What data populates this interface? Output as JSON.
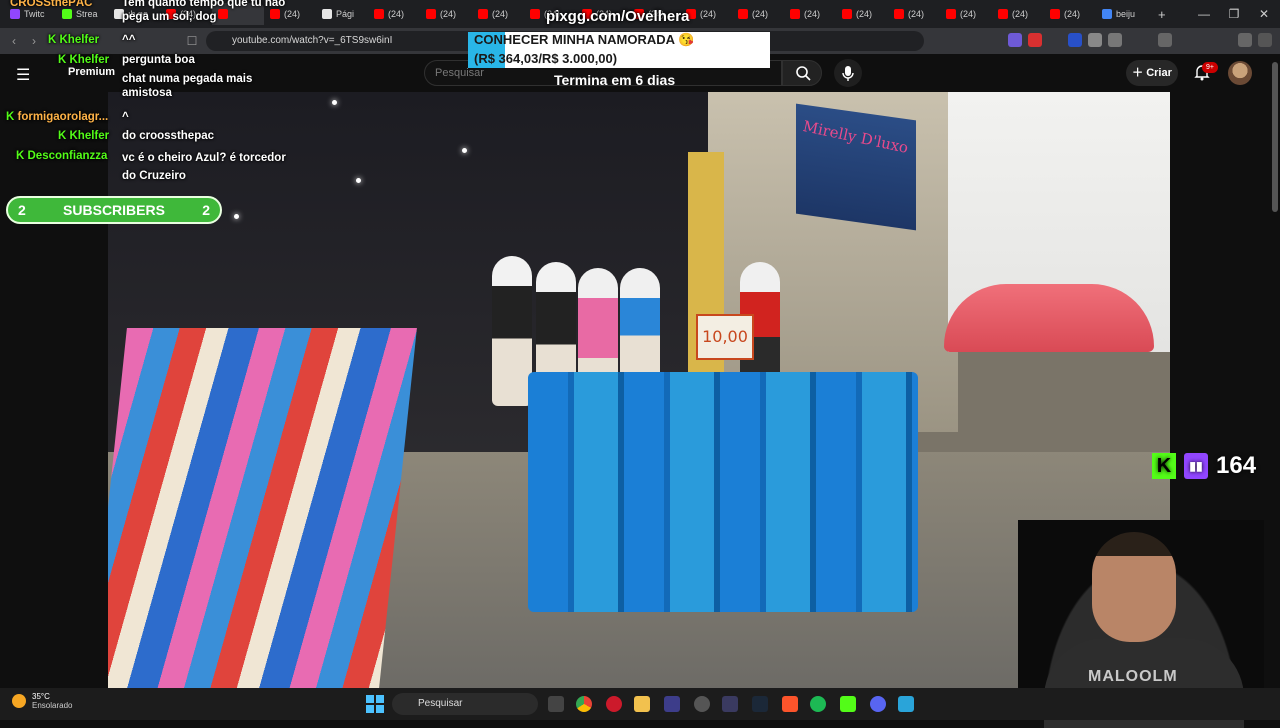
{
  "browser": {
    "tabs": [
      {
        "label": "Twitc",
        "color": "#9146ff"
      },
      {
        "label": "Strea",
        "color": "#53fc18"
      },
      {
        "label": "ıb.no",
        "color": "#e6e6e6"
      },
      {
        "label": "(24) ",
        "color": "#ff0000"
      },
      {
        "label": "",
        "color": "#ff0000",
        "active": true
      },
      {
        "label": "(24) ",
        "color": "#ff0000"
      },
      {
        "label": "Pági",
        "color": "#e6e6e6"
      },
      {
        "label": "(24) ",
        "color": "#ff0000"
      },
      {
        "label": "(24) ",
        "color": "#ff0000"
      },
      {
        "label": "(24) ",
        "color": "#ff0000"
      },
      {
        "label": "(24) ",
        "color": "#ff0000"
      },
      {
        "label": "(24) ",
        "color": "#ff0000"
      },
      {
        "label": "(24) ",
        "color": "#ff0000"
      },
      {
        "label": "(24) ",
        "color": "#ff0000"
      },
      {
        "label": "(24) ",
        "color": "#ff0000"
      },
      {
        "label": "(24) ",
        "color": "#ff0000"
      },
      {
        "label": "(24) ",
        "color": "#ff0000"
      },
      {
        "label": "(24) ",
        "color": "#ff0000"
      },
      {
        "label": "(24) ",
        "color": "#ff0000"
      },
      {
        "label": "(24) ",
        "color": "#ff0000"
      },
      {
        "label": "(24) ",
        "color": "#ff0000"
      },
      {
        "label": "beiju",
        "color": "#4285f4"
      }
    ],
    "new_tab": "+",
    "window_controls": {
      "minimize": "—",
      "maximize": "❐",
      "close": "✕"
    },
    "url": "youtube.com/watch?v=_6TS9sw6inI"
  },
  "youtube": {
    "logo_label": "Premium",
    "search_placeholder": "Pesquisar",
    "create_label": "Criar",
    "notification_count": "9+"
  },
  "chat": [
    {
      "user": "CROSStheΡAC",
      "message": "Tem quanto tempo que tu não pega um sol, dog"
    },
    {
      "user": "Khelfer",
      "message": "^^"
    },
    {
      "user": "Khelfer",
      "message": "pergunta boa"
    },
    {
      "user": "",
      "message": "chat numa pegada mais amistosa"
    },
    {
      "user": "",
      "message": "^"
    },
    {
      "user": "formigaorolagr...",
      "message": ""
    },
    {
      "user": "Khelfer",
      "message": "do croossthepac"
    },
    {
      "user": "Desconfianzza",
      "message": "vc é o cheiro Azul? é torcedor do Cruzeiro"
    }
  ],
  "donation_goal": {
    "site": "pixgg.com/Ovelhera",
    "title": "CONHECER MINHA NAMORADA 😘",
    "amount": "(R$ 364,03/R$ 3.000,00)",
    "progress": 0.1213,
    "ends": "Termina em 6 dias"
  },
  "subscribers": {
    "left": "2",
    "label": "SUBSCRIBERS",
    "right": "2"
  },
  "viewer_count": "164",
  "video": {
    "store_sign": "Mirelly D'luxo",
    "price_tag": "10,00",
    "cam_shirt": "MALOOLM"
  },
  "taskbar": {
    "temperature": "35°C",
    "weather": "Ensolarado",
    "search_label": "Pesquisar"
  },
  "colors": {
    "kick_green": "#53fc18",
    "twitch_purple": "#9146ff",
    "goal_blue": "#29b6e8",
    "youtube_red": "#ff0000"
  }
}
